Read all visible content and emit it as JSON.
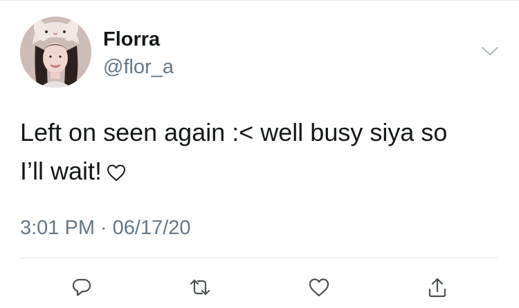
{
  "author": {
    "name": "Florra",
    "handle": "@flor_a",
    "avatar_icon": "profile-photo-icon"
  },
  "tweet": {
    "text_line_1": "Left on seen again :< well busy siya so",
    "text_line_2": "I’ll wait!",
    "text_emoji_icon": "heart-outline-icon",
    "time": "3:01 PM",
    "separator": "·",
    "date": "06/17/20"
  },
  "actions": {
    "reply_icon": "reply-icon",
    "retweet_icon": "retweet-icon",
    "like_icon": "like-icon",
    "share_icon": "share-icon",
    "menu_icon": "chevron-down-icon"
  },
  "colors": {
    "text": "#14171a",
    "secondary": "#657786",
    "divider": "#e1e8ed",
    "background": "#ffffff"
  }
}
